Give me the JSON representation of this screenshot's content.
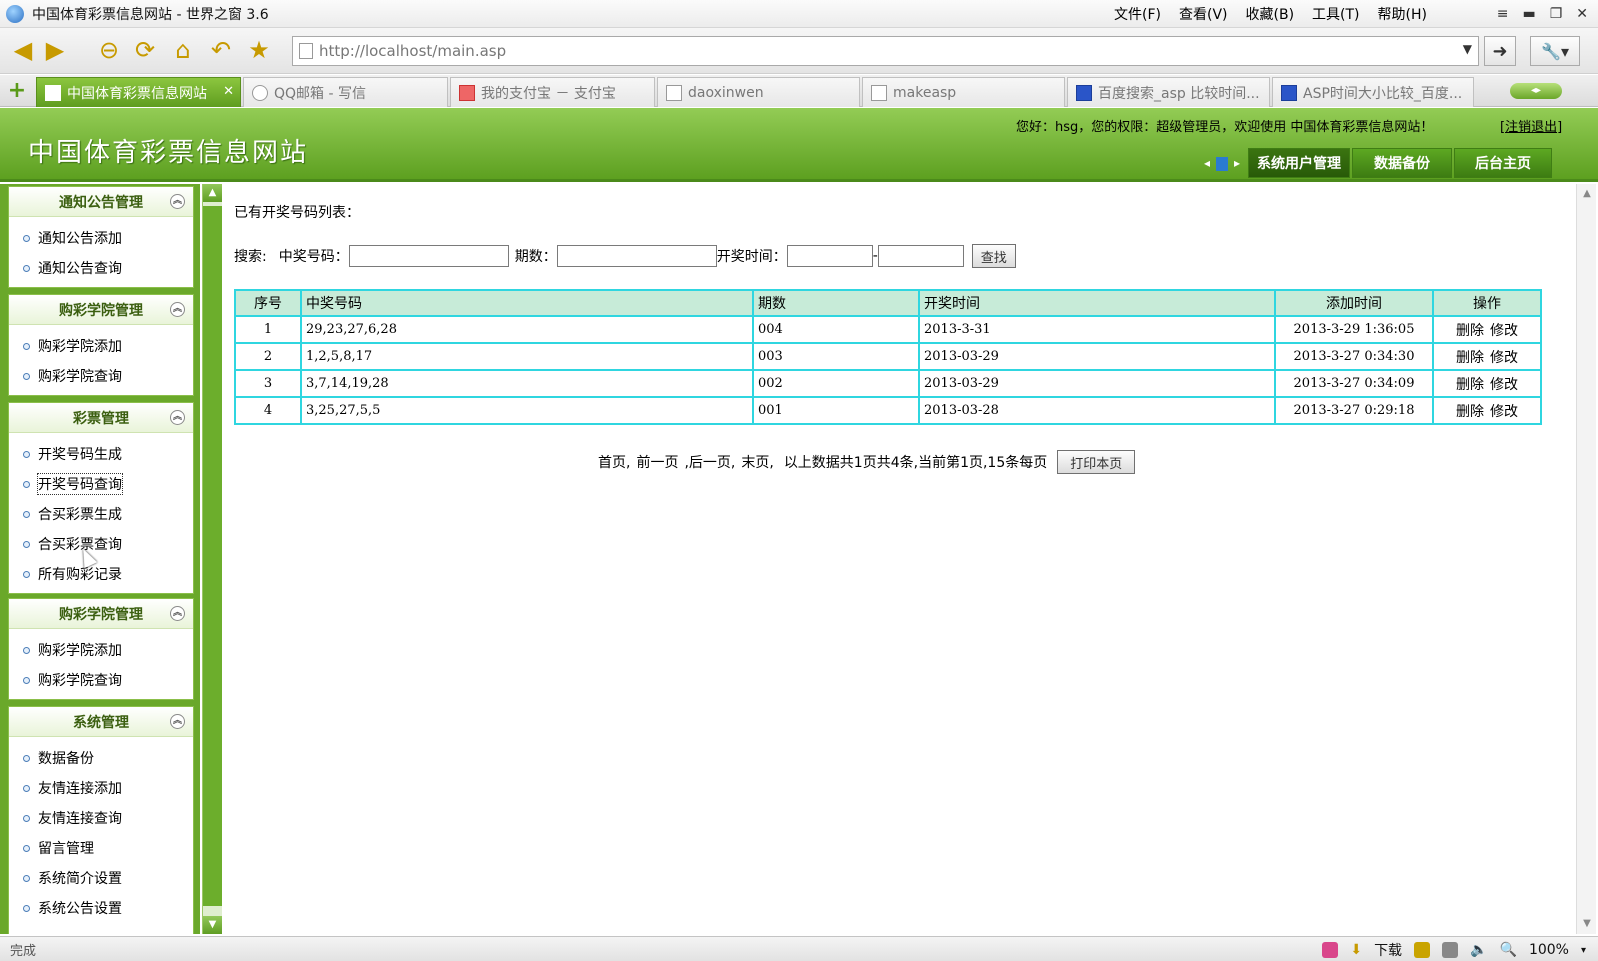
{
  "browser": {
    "window_title": "中国体育彩票信息网站 - 世界之窗 3.6",
    "menu": [
      "文件(F)",
      "查看(V)",
      "收藏(B)",
      "工具(T)",
      "帮助(H)"
    ],
    "address": "http://localhost/main.asp",
    "tabs": [
      {
        "label": "中国体育彩票信息网站",
        "active": true
      },
      {
        "label": "QQ邮箱 - 写信",
        "active": false
      },
      {
        "label": "我的支付宝 － 支付宝",
        "active": false
      },
      {
        "label": "daoxinwen",
        "active": false
      },
      {
        "label": "makeasp",
        "active": false
      },
      {
        "label": "百度搜索_asp 比较时间...",
        "active": false
      },
      {
        "label": "ASP时间大小比较_百度...",
        "active": false
      }
    ],
    "status": "完成",
    "status_download": "下载",
    "zoom": "100%"
  },
  "header": {
    "site_title": "中国体育彩票信息网站",
    "welcome": "您好：hsg，您的权限：超级管理员，欢迎使用 中国体育彩票信息网站！",
    "logout": "[注销退出]",
    "nav": [
      "系统用户管理",
      "数据备份",
      "后台主页"
    ]
  },
  "sidebar": {
    "panels": [
      {
        "title": "通知公告管理",
        "items": [
          "通知公告添加",
          "通知公告查询"
        ]
      },
      {
        "title": "购彩学院管理",
        "items": [
          "购彩学院添加",
          "购彩学院查询"
        ]
      },
      {
        "title": "彩票管理",
        "items": [
          "开奖号码生成",
          "开奖号码查询",
          "合买彩票生成",
          "合买彩票查询",
          "所有购彩记录"
        ]
      },
      {
        "title": "购彩学院管理",
        "items": [
          "购彩学院添加",
          "购彩学院查询"
        ]
      },
      {
        "title": "系统管理",
        "items": [
          "数据备份",
          "友情连接添加",
          "友情连接查询",
          "留言管理",
          "系统简介设置",
          "系统公告设置"
        ]
      }
    ]
  },
  "main": {
    "list_title": "已有开奖号码列表：",
    "search": {
      "label": "搜索:",
      "number_label": "中奖号码：",
      "period_label": "期数：",
      "time_label": "开奖时间：",
      "separator": "-",
      "button": "查找"
    },
    "table": {
      "headers": [
        "序号",
        "中奖号码",
        "期数",
        "开奖时间",
        "添加时间",
        "操作"
      ],
      "rows": [
        {
          "no": "1",
          "numbers": "29,23,27,6,28",
          "period": "004",
          "draw_time": "2013-3-31",
          "add_time": "2013-3-29 1:36:05"
        },
        {
          "no": "2",
          "numbers": "1,2,5,8,17",
          "period": "003",
          "draw_time": "2013-03-29",
          "add_time": "2013-3-27 0:34:30"
        },
        {
          "no": "3",
          "numbers": "3,7,14,19,28",
          "period": "002",
          "draw_time": "2013-03-29",
          "add_time": "2013-3-27 0:34:09"
        },
        {
          "no": "4",
          "numbers": "3,25,27,5,5",
          "period": "001",
          "draw_time": "2013-03-28",
          "add_time": "2013-3-27 0:29:18"
        }
      ],
      "delete_label": "删除",
      "edit_label": "修改"
    },
    "pager": {
      "first": "首页,",
      "prev": "前一页",
      "next": ",后一页,",
      "last": "末页,",
      "info": "以上数据共1页共4条,当前第1页,15条每页",
      "print": "打印本页"
    }
  }
}
